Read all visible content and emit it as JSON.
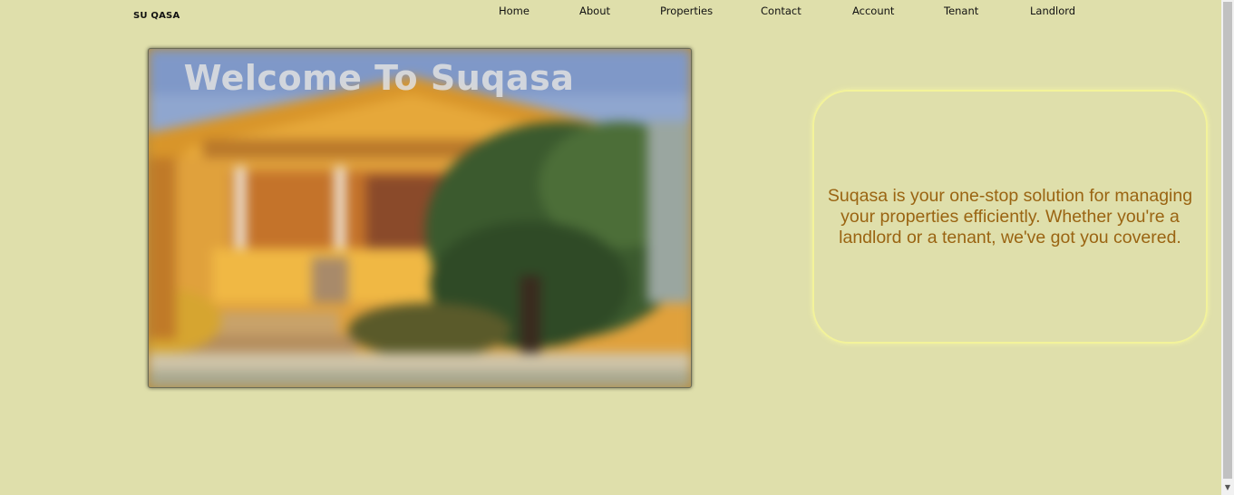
{
  "header": {
    "brand": "SU QASA",
    "nav": [
      "Home",
      "About",
      "Properties",
      "Contact",
      "Account",
      "Tenant",
      "Landlord"
    ]
  },
  "hero": {
    "title": "Welcome To Suqasa"
  },
  "info_card": {
    "text": "Suqasa is your one-stop solution for managing your properties efficiently. Whether you're a landlord or a tenant, we've got you covered."
  },
  "colors": {
    "background": "#dfdfab",
    "card_border": "#f3f39a",
    "card_text": "#9a6412"
  },
  "icons": {
    "scroll_down": "triangle-down"
  }
}
